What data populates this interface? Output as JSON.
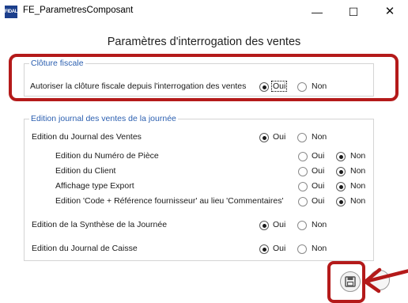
{
  "window": {
    "title": "FE_ParametresComposant",
    "icon_text": "FIDAL",
    "minimize_glyph": "—",
    "maximize_glyph": "☐",
    "close_glyph": "✕"
  },
  "heading": "Paramètres d'interrogation des ventes",
  "cloture": {
    "group_title": "Clôture fiscale",
    "row_label": "Autoriser la clôture fiscale depuis l'interrogation des ventes",
    "oui": "Oui",
    "non": "Non",
    "selected": "oui"
  },
  "edition": {
    "group_title": "Edition journal des ventes de la journée",
    "rows": [
      {
        "label": "Edition du Journal des Ventes",
        "oui": "Oui",
        "non": "Non",
        "selected": "oui"
      },
      {
        "label": "Edition du Numéro de Pièce",
        "oui": "Oui",
        "non": "Non",
        "selected": "non"
      },
      {
        "label": "Edition du Client",
        "oui": "Oui",
        "non": "Non",
        "selected": "non"
      },
      {
        "label": "Affichage type Export",
        "oui": "Oui",
        "non": "Non",
        "selected": "non"
      },
      {
        "label": "Edition 'Code + Référence fournisseur' au lieu 'Commentaires'",
        "oui": "Oui",
        "non": "Non",
        "selected": "non"
      },
      {
        "label": "Edition de la Synthèse de la Journée",
        "oui": "Oui",
        "non": "Non",
        "selected": "oui"
      },
      {
        "label": "Edition du Journal de Caisse",
        "oui": "Oui",
        "non": "Non",
        "selected": "oui"
      }
    ]
  },
  "colors": {
    "highlight": "#b41a1a",
    "group_title": "#2b5fb0",
    "app_icon": "#1c3f8c"
  }
}
